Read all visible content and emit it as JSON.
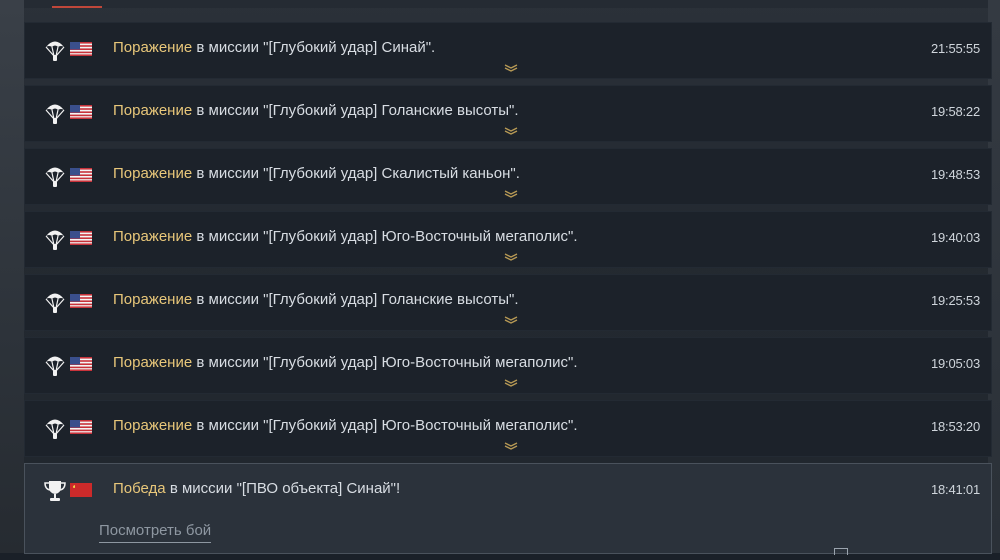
{
  "colors": {
    "result": "#e8c77a",
    "text": "#d8dde3",
    "tab_accent": "#c0473a"
  },
  "rows": [
    {
      "mode_icon": "parachute-icon",
      "flag": "us-flag-icon",
      "result": "Поражение",
      "text": " в миссии \"[Глубокий удар] Синай\".",
      "time": "21:55:55"
    },
    {
      "mode_icon": "parachute-icon",
      "flag": "us-flag-icon",
      "result": "Поражение",
      "text": " в миссии \"[Глубокий удар] Голанские высоты\".",
      "time": "19:58:22"
    },
    {
      "mode_icon": "parachute-icon",
      "flag": "us-flag-icon",
      "result": "Поражение",
      "text": " в миссии \"[Глубокий удар] Скалистый каньон\".",
      "time": "19:48:53"
    },
    {
      "mode_icon": "parachute-icon",
      "flag": "us-flag-icon",
      "result": "Поражение",
      "text": " в миссии \"[Глубокий удар] Юго-Восточный мегаполис\".",
      "time": "19:40:03"
    },
    {
      "mode_icon": "parachute-icon",
      "flag": "us-flag-icon",
      "result": "Поражение",
      "text": " в миссии \"[Глубокий удар] Голанские высоты\".",
      "time": "19:25:53"
    },
    {
      "mode_icon": "parachute-icon",
      "flag": "us-flag-icon",
      "result": "Поражение",
      "text": " в миссии \"[Глубокий удар] Юго-Восточный мегаполис\".",
      "time": "19:05:03"
    },
    {
      "mode_icon": "parachute-icon",
      "flag": "us-flag-icon",
      "result": "Поражение",
      "text": " в миссии \"[Глубокий удар] Юго-Восточный мегаполис\".",
      "time": "18:53:20"
    }
  ],
  "selected_row": {
    "mode_icon": "trophy-icon",
    "flag": "ussr-flag-icon",
    "result": "Победа",
    "text": " в миссии \"[ПВО объекта] Синай\"!",
    "time": "18:41:01",
    "view_battle_label": "Посмотреть бой"
  }
}
